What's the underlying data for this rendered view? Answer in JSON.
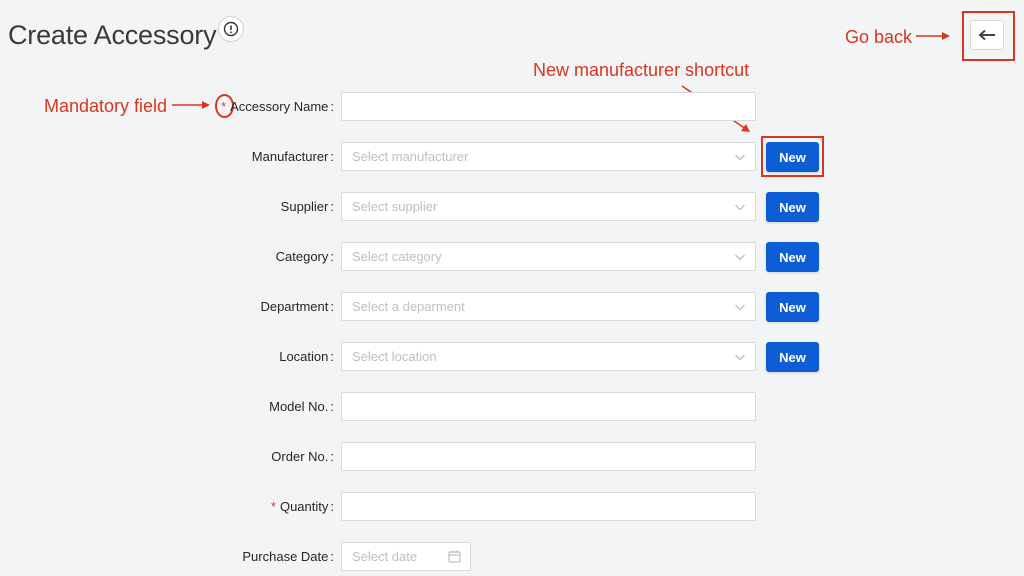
{
  "header": {
    "title": "Create Accessory",
    "info_icon": "info-circle-icon",
    "back_icon": "arrow-left-icon"
  },
  "annotations": {
    "mandatory": "Mandatory field",
    "new_shortcut": "New manufacturer shortcut",
    "go_back": "Go back",
    "color": "#d9361e"
  },
  "form": {
    "accessory_name": {
      "label": "Accessory Name",
      "required": "*",
      "placeholder": ""
    },
    "manufacturer": {
      "label": "Manufacturer",
      "placeholder": "Select manufacturer",
      "new": "New"
    },
    "supplier": {
      "label": "Supplier",
      "placeholder": "Select supplier",
      "new": "New"
    },
    "category": {
      "label": "Category",
      "placeholder": "Select category",
      "new": "New"
    },
    "department": {
      "label": "Department",
      "placeholder": "Select a deparment",
      "new": "New"
    },
    "location": {
      "label": "Location",
      "placeholder": "Select location",
      "new": "New"
    },
    "model_no": {
      "label": "Model No.",
      "placeholder": ""
    },
    "order_no": {
      "label": "Order No.",
      "placeholder": ""
    },
    "quantity": {
      "label": "Quantity",
      "required": "*",
      "placeholder": ""
    },
    "purchase_date": {
      "label": "Purchase Date",
      "placeholder": "Select date"
    }
  },
  "colors": {
    "primary_button": "#0d5ed4",
    "required_asterisk": "#e2372b"
  }
}
